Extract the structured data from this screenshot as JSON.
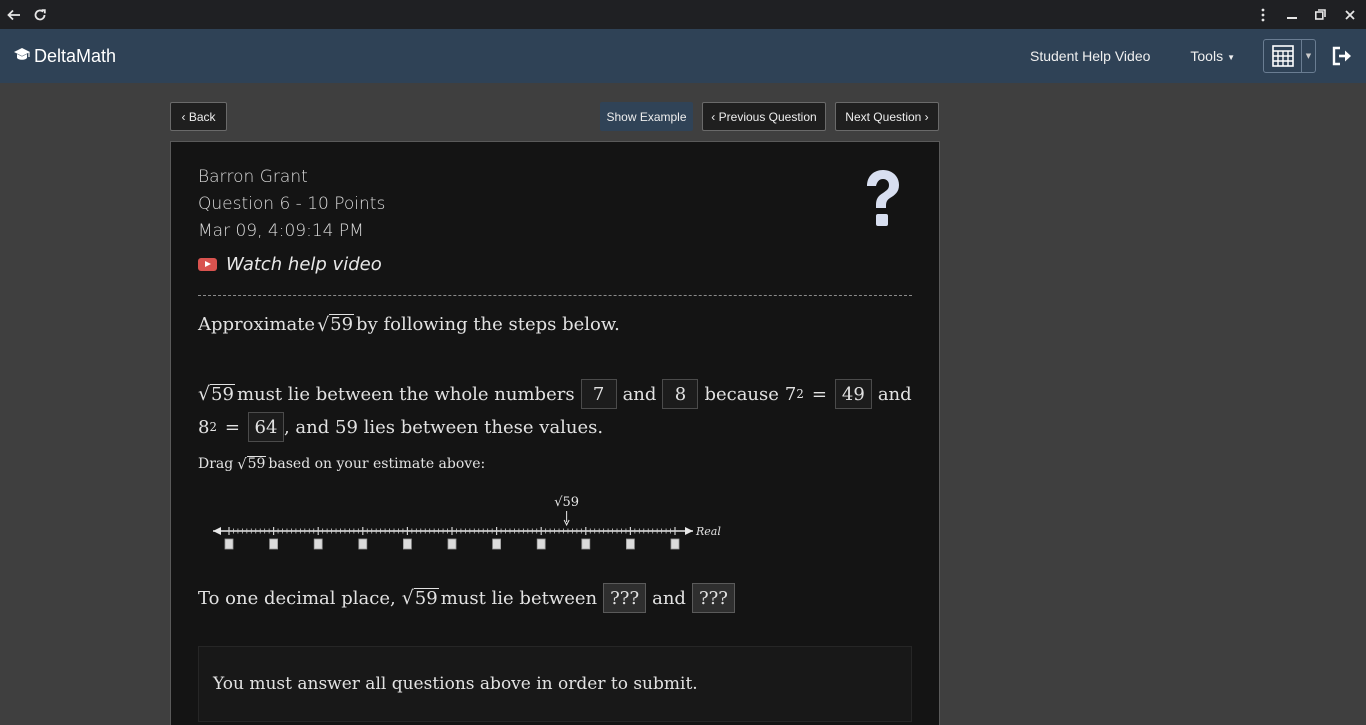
{
  "browser": {
    "back_icon": "arrow-left-icon",
    "reload_icon": "reload-icon"
  },
  "app": {
    "brand": "DeltaMath",
    "nav": {
      "help_video": "Student Help Video",
      "tools": "Tools"
    }
  },
  "actions": {
    "back": "Back",
    "show_example": "Show Example",
    "previous": "Previous Question",
    "next": "Next Question"
  },
  "question": {
    "student": "Barron Grant",
    "title": "Question 6 - 10 Points",
    "date": "Mar 09, 4:09:14 PM",
    "help_link": "Watch help video",
    "prompt_prefix": "Approximate",
    "radicand": "59",
    "prompt_suffix": "by following the steps below.",
    "step1": {
      "text_a": "must lie between the whole numbers",
      "lower": "7",
      "and": "and",
      "upper": "8",
      "because": "because",
      "base_a": "7",
      "exp": "2",
      "eq": "=",
      "square_a": "49",
      "and2": "and",
      "base_b": "8",
      "square_b": "64",
      "tail": ", and 59 lies between these values."
    },
    "drag": {
      "prefix": "Drag",
      "suffix": "based on your estimate above:"
    },
    "numberline": {
      "label": "√59",
      "axis_label": "Real",
      "marker_fraction": 0.757
    },
    "step2": {
      "prefix": "To one decimal place,",
      "middle": "must lie between",
      "lower_placeholder": "???",
      "and": "and",
      "upper_placeholder": "???"
    },
    "notice": "You must answer all questions above in order to submit."
  }
}
